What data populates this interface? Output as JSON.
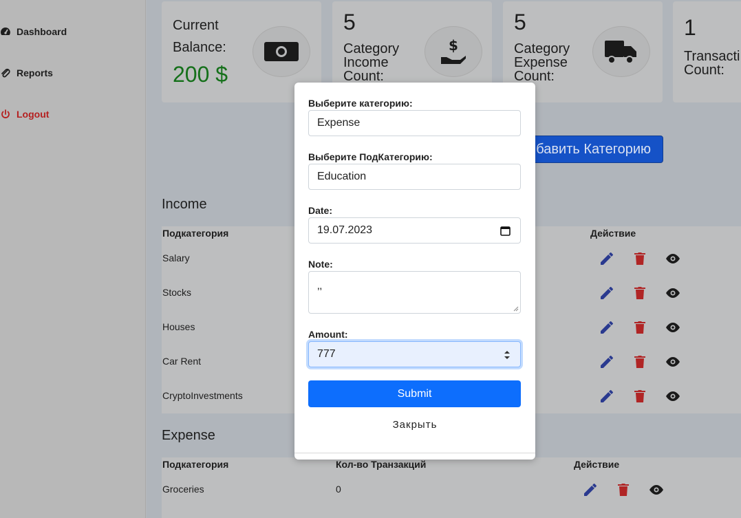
{
  "sidebar": {
    "items": [
      {
        "label": "Dashboard",
        "icon": "gauge-icon"
      },
      {
        "label": "Reports",
        "icon": "paperclip-icon"
      },
      {
        "label": "Logout",
        "icon": "power-icon"
      }
    ]
  },
  "cards": {
    "balance": {
      "label_line1": "Current",
      "label_line2": "Balance:",
      "value": "200 $",
      "icon": "money-bill-icon"
    },
    "income_count": {
      "value": "5",
      "label_line1": "Category",
      "label_line2": "Income",
      "label_line3": "Count:",
      "icon": "hand-dollar-icon"
    },
    "expense_count": {
      "value": "5",
      "label_line1": "Category",
      "label_line2": "Expense",
      "label_line3": "Count:",
      "icon": "truck-icon"
    },
    "transaction_count": {
      "value": "1",
      "label_line1": "Transacti",
      "label_line2": "Count:"
    }
  },
  "add_category_label": "бавить Категорию",
  "income": {
    "title": "Income",
    "headers": {
      "subcategory": "Подкатегория",
      "action": "Действие"
    },
    "rows": [
      "Salary",
      "Stocks",
      "Houses",
      "Car Rent",
      "CryptoInvestments"
    ]
  },
  "expense": {
    "title": "Expense",
    "headers": {
      "subcategory": "Подкатегория",
      "count": "Кол-во Транзакций",
      "action": "Действие"
    },
    "rows": [
      {
        "name": "Groceries",
        "count": "0"
      }
    ]
  },
  "modal": {
    "category_label": "Выберите категорию:",
    "category_value": "Expense",
    "subcategory_label": "Выберите ПодКатегорию:",
    "subcategory_value": "Education",
    "date_label": "Date:",
    "date_value": "19.07.2023",
    "note_label": "Note:",
    "note_value": "‚‚",
    "amount_label": "Amount:",
    "amount_value": "777",
    "submit_label": "Submit",
    "close_label": "Закрыть"
  },
  "colors": {
    "accent": "#0d6efd",
    "edit": "#2a3a8f",
    "delete": "#b02525",
    "balance": "#15701a",
    "logout": "#b52020"
  }
}
